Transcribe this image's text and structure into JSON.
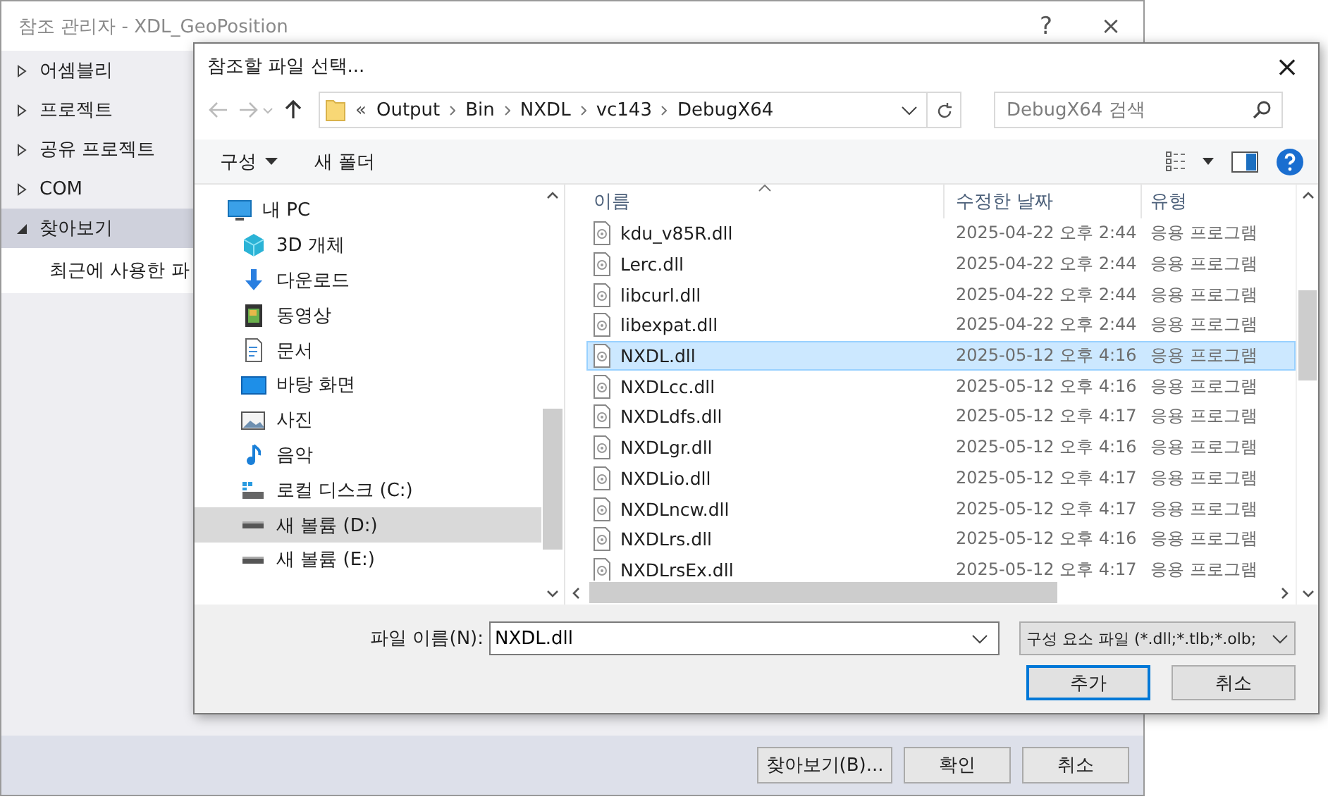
{
  "window": {
    "title": "참조 관리자 - XDL_GeoPosition",
    "help": "?",
    "close": "×"
  },
  "sidebar": {
    "items": [
      {
        "label": "어셈블리",
        "expanded": false,
        "selected": false
      },
      {
        "label": "프로젝트",
        "expanded": false,
        "selected": false
      },
      {
        "label": "공유 프로젝트",
        "expanded": false,
        "selected": false
      },
      {
        "label": "COM",
        "expanded": false,
        "selected": false
      },
      {
        "label": "찾아보기",
        "expanded": true,
        "selected": true,
        "children": [
          {
            "label": "최근에 사용한 파",
            "selected": false
          }
        ]
      }
    ]
  },
  "buttons": [
    "찾아보기(B)...",
    "확인",
    "취소"
  ],
  "dialog": {
    "title": "참조할 파일 선택...",
    "close": "×",
    "address": {
      "prefix": "«",
      "segments": [
        "Output",
        "Bin",
        "NXDL",
        "vc143",
        "DebugX64"
      ]
    },
    "search": {
      "placeholder": "DebugX64 검색"
    },
    "toolbar": [
      {
        "label": "구성",
        "dropdown": true
      },
      {
        "label": "새 폴더",
        "dropdown": false
      }
    ],
    "nav": [
      {
        "label": "내 PC",
        "kind": "pc",
        "selected": false,
        "children": [
          {
            "label": "3D 개체",
            "kind": "cube",
            "selected": false
          },
          {
            "label": "다운로드",
            "kind": "download",
            "selected": false
          },
          {
            "label": "동영상",
            "kind": "video",
            "selected": false
          },
          {
            "label": "문서",
            "kind": "document",
            "selected": false
          },
          {
            "label": "바탕 화면",
            "kind": "desktop",
            "selected": false
          },
          {
            "label": "사진",
            "kind": "photo",
            "selected": false
          },
          {
            "label": "음악",
            "kind": "music",
            "selected": false
          },
          {
            "label": "로컬 디스크 (C:)",
            "kind": "system-drive",
            "selected": false
          },
          {
            "label": "새 볼륨 (D:)",
            "kind": "drive",
            "selected": true
          },
          {
            "label": "새 볼륨 (E:)",
            "kind": "drive",
            "selected": false
          }
        ]
      }
    ],
    "files": {
      "columns": [
        "이름",
        "수정한 날짜",
        "유형"
      ],
      "rows": [
        {
          "name": "kdu_v85R.dll",
          "date": "2025-04-22 오후 2:44",
          "type": "응용 프로그램",
          "selected": false
        },
        {
          "name": "Lerc.dll",
          "date": "2025-04-22 오후 2:44",
          "type": "응용 프로그램",
          "selected": false
        },
        {
          "name": "libcurl.dll",
          "date": "2025-04-22 오후 2:44",
          "type": "응용 프로그램",
          "selected": false
        },
        {
          "name": "libexpat.dll",
          "date": "2025-04-22 오후 2:44",
          "type": "응용 프로그램",
          "selected": false
        },
        {
          "name": "NXDL.dll",
          "date": "2025-05-12 오후 4:16",
          "type": "응용 프로그램",
          "selected": true
        },
        {
          "name": "NXDLcc.dll",
          "date": "2025-05-12 오후 4:16",
          "type": "응용 프로그램",
          "selected": false
        },
        {
          "name": "NXDLdfs.dll",
          "date": "2025-05-12 오후 4:17",
          "type": "응용 프로그램",
          "selected": false
        },
        {
          "name": "NXDLgr.dll",
          "date": "2025-05-12 오후 4:16",
          "type": "응용 프로그램",
          "selected": false
        },
        {
          "name": "NXDLio.dll",
          "date": "2025-05-12 오후 4:17",
          "type": "응용 프로그램",
          "selected": false
        },
        {
          "name": "NXDLncw.dll",
          "date": "2025-05-12 오후 4:17",
          "type": "응용 프로그램",
          "selected": false
        },
        {
          "name": "NXDLrs.dll",
          "date": "2025-05-12 오후 4:16",
          "type": "응용 프로그램",
          "selected": false
        },
        {
          "name": "NXDLrsEx.dll",
          "date": "2025-05-12 오후 4:17",
          "type": "응용 프로그램",
          "selected": false
        }
      ]
    },
    "filename": {
      "label": "파일 이름(N):",
      "value": "NXDL.dll"
    },
    "filter": "구성 요소 파일 (*.dll;*.tlb;*.olb;",
    "buttons": [
      {
        "label": "추가",
        "default": true
      },
      {
        "label": "취소",
        "default": false
      }
    ]
  }
}
